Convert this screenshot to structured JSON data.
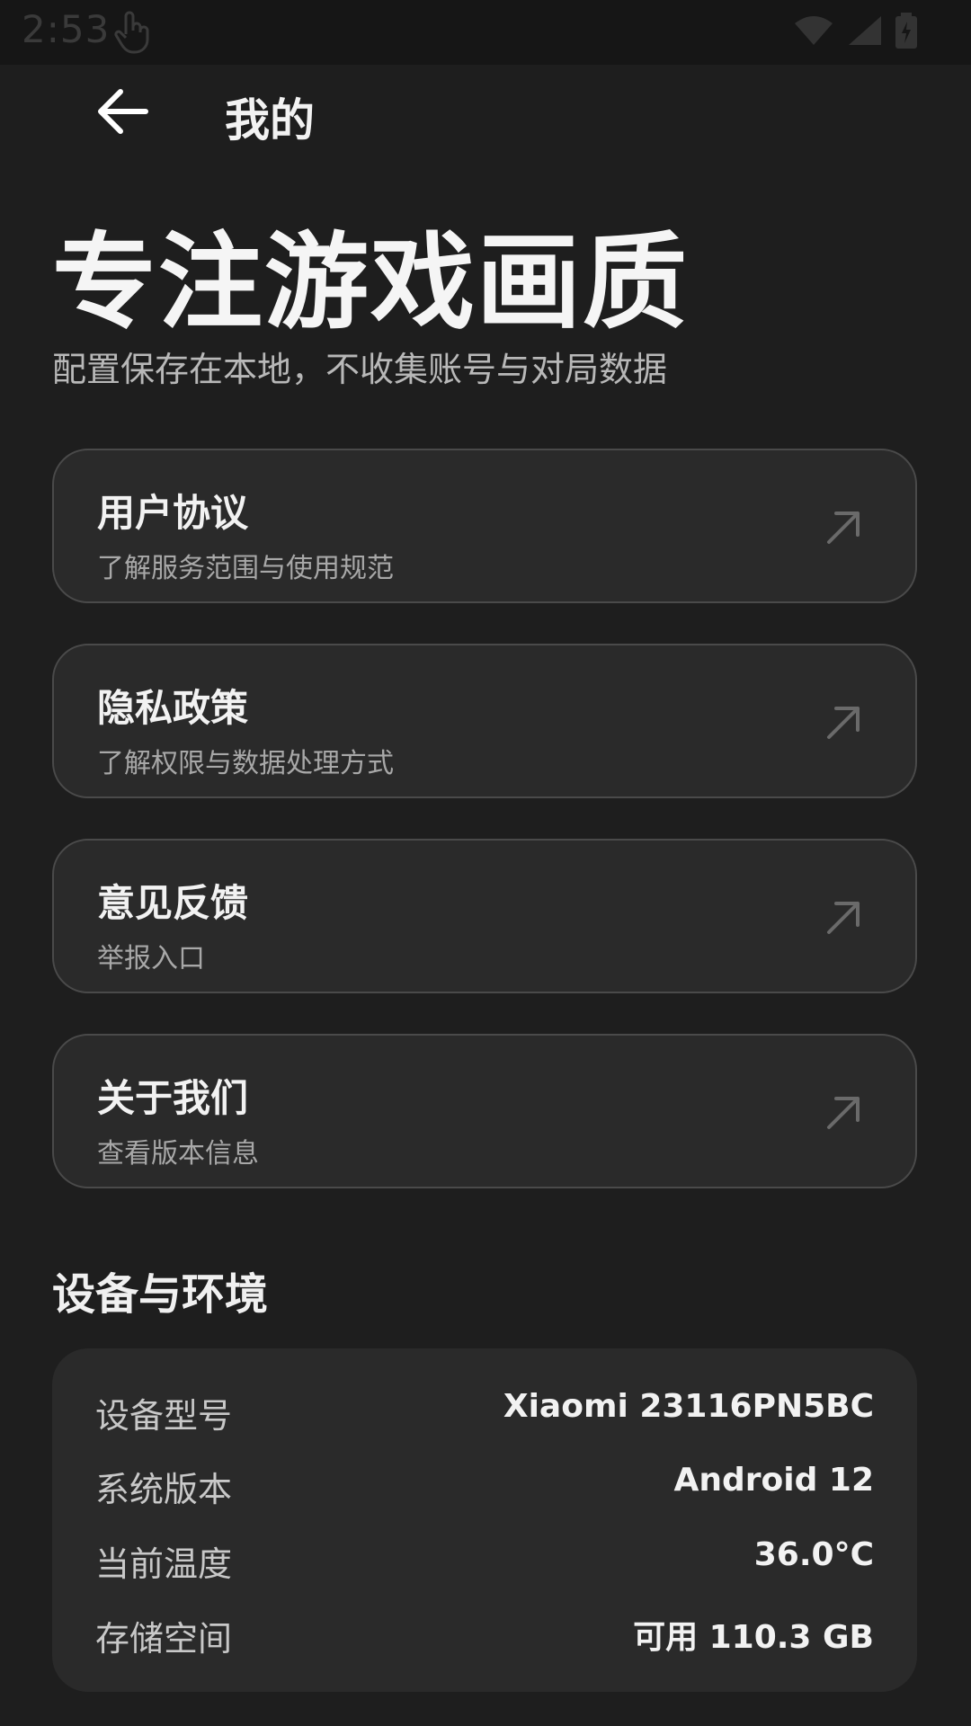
{
  "status": {
    "time": "2:53"
  },
  "header": {
    "title": "我的"
  },
  "hero": {
    "title": "专注游戏画质",
    "subtitle": "配置保存在本地，不收集账号与对局数据"
  },
  "menu": [
    {
      "title": "用户协议",
      "subtitle": "了解服务范围与使用规范"
    },
    {
      "title": "隐私政策",
      "subtitle": "了解权限与数据处理方式"
    },
    {
      "title": "意见反馈",
      "subtitle": "举报入口"
    },
    {
      "title": "关于我们",
      "subtitle": "查看版本信息"
    }
  ],
  "device": {
    "section_title": "设备与环境",
    "rows": [
      {
        "label": "设备型号",
        "value": "Xiaomi 23116PN5BC"
      },
      {
        "label": "系统版本",
        "value": "Android 12"
      },
      {
        "label": "当前温度",
        "value": "36.0°C"
      },
      {
        "label": "存储空间",
        "value": "可用 110.3 GB"
      }
    ]
  },
  "icons": {
    "back": "arrow-left-icon",
    "external": "arrow-up-right-icon",
    "touch": "hand-pointer-icon",
    "wifi": "wifi-icon",
    "signal": "signal-icon",
    "battery": "battery-charging-icon"
  }
}
